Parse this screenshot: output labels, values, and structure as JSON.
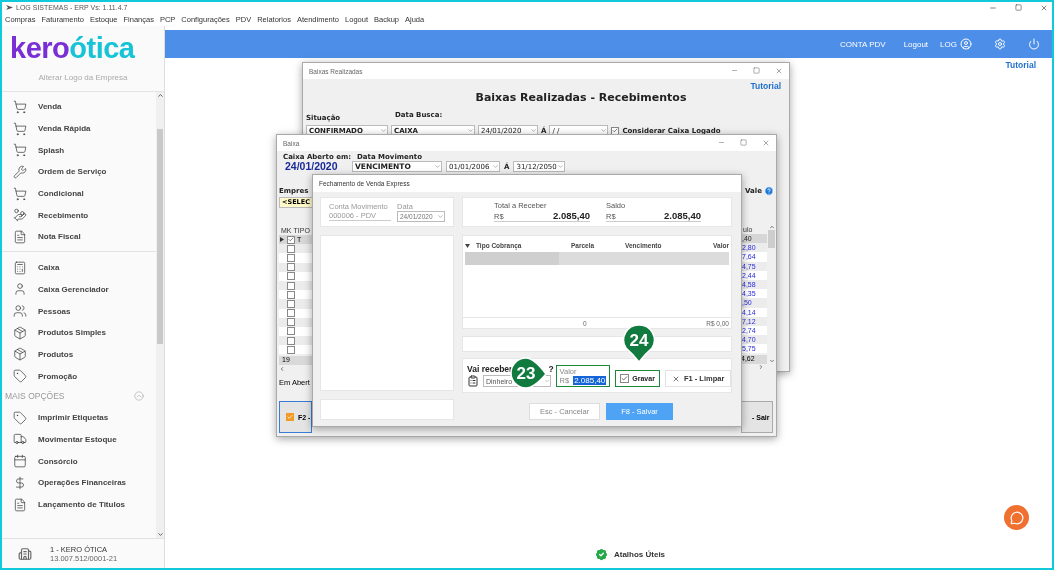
{
  "app": {
    "title": "LOG SISTEMAS - ERP Vs: 1.11.4.7",
    "menu": [
      "Compras",
      "Faturamento",
      "Estoque",
      "Finanças",
      "PCP",
      "Configurações",
      "PDV",
      "Relatorios",
      "Atendimento",
      "Logout",
      "Backup",
      "Ajuda"
    ]
  },
  "header": {
    "account": "CONTA PDV",
    "logout": "Logout",
    "user": "LOG",
    "tutorial": "Tutorial"
  },
  "sidebar": {
    "logo": {
      "first": "kero",
      "second": "ótica"
    },
    "logo_caption": "Alterar Logo da Empresa",
    "sections": [
      {
        "items": [
          "Venda",
          "Venda Rápida",
          "Splash",
          "Ordem de Serviço",
          "Condicional",
          "Recebimento",
          "Nota Fiscal"
        ]
      },
      {
        "items": [
          "Caixa",
          "Caixa Gerenciador",
          "Pessoas",
          "Produtos Simples",
          "Produtos",
          "Promoção"
        ]
      },
      {
        "title": "MAIS OPÇÕES",
        "expanded": true,
        "items": [
          "Imprimir Etiquetas",
          "Movimentar Estoque",
          "Consórcio",
          "Operações Financeiras",
          "Lançamento de Titulos"
        ]
      }
    ],
    "company": {
      "name": "1 - KERO ÓTICA",
      "cnpj": "13.007.512/0001-21"
    }
  },
  "baixas_realizadas": {
    "title": "Baixas Realizadas",
    "tutorial": "Tutorial",
    "heading": "Baixas Realizadas - Recebimentos",
    "situacao_label": "Situação",
    "situacao": "CONFIRMADO",
    "data_busca_label": "Data Busca:",
    "data_busca": "CAIXA",
    "date_from": "24/01/2020",
    "separator": "Á",
    "date_to": "/ /",
    "considerar": {
      "label": "Considerar Caixa Logado",
      "checked": true
    }
  },
  "baixa": {
    "title": "Baixa",
    "caixa_label": "Caixa Aberto em:",
    "caixa_date": "24/01/2020",
    "movimento_label": "Data Movimento",
    "movimento": "VENCIMENTO",
    "date_from": "01/01/2006",
    "separator": "Á",
    "date_to": "31/12/2050",
    "empresa_label": "Empres",
    "empresa": "<SELEC",
    "vale": "Vale",
    "columns": [
      "MK",
      "TIPO"
    ],
    "value_column": "ulo",
    "rows": [
      {
        "selected": true,
        "checked": true,
        "type": "T",
        "value": ",40"
      },
      {
        "selected": false,
        "checked": false,
        "value": "2,80"
      },
      {
        "selected": false,
        "checked": false,
        "value": "7,64"
      },
      {
        "selected": false,
        "checked": false,
        "value": "4,75"
      },
      {
        "selected": false,
        "checked": false,
        "value": "2,44"
      },
      {
        "selected": false,
        "checked": false,
        "value": "4,58"
      },
      {
        "selected": false,
        "checked": false,
        "value": "4,35"
      },
      {
        "selected": false,
        "checked": false,
        "value": ",50"
      },
      {
        "selected": false,
        "checked": false,
        "value": "4,14"
      },
      {
        "selected": false,
        "checked": false,
        "value": "7,12"
      },
      {
        "selected": false,
        "checked": false,
        "value": "2,74"
      },
      {
        "selected": false,
        "checked": false,
        "value": "4,70"
      },
      {
        "selected": false,
        "checked": false,
        "value": "5,75"
      }
    ],
    "count": "19",
    "total": "4,62",
    "status": "Em Abert",
    "f2_button": "F2 -",
    "exit_button": "- Sair"
  },
  "fechamento": {
    "title": "Fechamento de Venda Express",
    "conta_label": "Conta Movimento",
    "conta": "000006 - PDV",
    "data_label": "Data",
    "data": "24/01/2020",
    "total_label": "Total a Receber",
    "total_currency": "R$",
    "total": "2.085,40",
    "saldo_label": "Saldo",
    "saldo_currency": "R$",
    "saldo": "2.085,40",
    "columns": [
      "Tipo Cobrança",
      "Parcela",
      "Vencimento",
      "Valor"
    ],
    "footer_count": "0",
    "footer_total": "R$ 0,00",
    "question": "Vai receber",
    "question_mark": "?",
    "payment": "Dinheiro",
    "valor_label": "Valor",
    "valor_currency": "R$",
    "valor": "2.085,40",
    "gravar": {
      "label": "Gravar",
      "checked": true
    },
    "clear_button": "F1 - Limpar",
    "cancel_button": "Esc - Cancelar",
    "save_button": "F8 - Salvar"
  },
  "callouts": [
    {
      "label": "23",
      "kind": "right"
    },
    {
      "label": "24",
      "kind": "down"
    }
  ],
  "shortcuts": {
    "label": "Atalhos Úteis"
  }
}
